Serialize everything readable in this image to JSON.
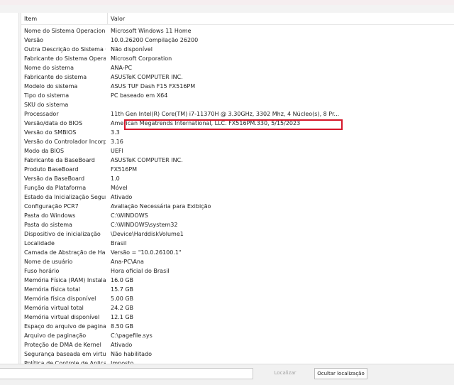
{
  "header": {
    "item": "Item",
    "value": "Valor"
  },
  "rows": [
    {
      "item": "Nome do Sistema Operacional",
      "value": "Microsoft Windows 11 Home"
    },
    {
      "item": "Versão",
      "value": "10.0.26200 Compilação 26200"
    },
    {
      "item": "Outra Descrição do Sistema O...",
      "value": "Não disponível"
    },
    {
      "item": "Fabricante do Sistema Operaci...",
      "value": "Microsoft Corporation"
    },
    {
      "item": "Nome do sistema",
      "value": "ANA-PC"
    },
    {
      "item": "Fabricante do sistema",
      "value": "ASUSTeK COMPUTER INC."
    },
    {
      "item": "Modelo do sistema",
      "value": "ASUS TUF Dash F15 FX516PM"
    },
    {
      "item": "Tipo do sistema",
      "value": "PC baseado em X64"
    },
    {
      "item": "SKU do sistema",
      "value": ""
    },
    {
      "item": "Processador",
      "value": "11th Gen Intel(R) Core(TM) i7-11370H @ 3.30GHz, 3302 Mhz, 4 Núcleo(s), 8 Pr..."
    },
    {
      "item": "Versão/data do BIOS",
      "value": "American Megatrends International, LLC. FX516PM.330, 5/15/2023"
    },
    {
      "item": "Versão do SMBIOS",
      "value": "3.3"
    },
    {
      "item": "Versão do Controlador Incorp...",
      "value": "3.16"
    },
    {
      "item": "Modo da BIOS",
      "value": "UEFI"
    },
    {
      "item": "Fabricante da BaseBoard",
      "value": "ASUSTeK COMPUTER INC."
    },
    {
      "item": "Produto BaseBoard",
      "value": "FX516PM"
    },
    {
      "item": "Versão da BaseBoard",
      "value": "1.0"
    },
    {
      "item": "Função da Plataforma",
      "value": "Móvel"
    },
    {
      "item": "Estado da Inicialização Segura",
      "value": "Ativado"
    },
    {
      "item": "Configuração PCR7",
      "value": "Avaliação Necessária para Exibição"
    },
    {
      "item": "Pasta do Windows",
      "value": "C:\\WINDOWS"
    },
    {
      "item": "Pasta do sistema",
      "value": "C:\\WINDOWS\\system32"
    },
    {
      "item": "Dispositivo de inicialização",
      "value": "\\Device\\HarddiskVolume1"
    },
    {
      "item": "Localidade",
      "value": "Brasil"
    },
    {
      "item": "Camada de Abstração de Hard...",
      "value": "Versão = \"10.0.26100.1\""
    },
    {
      "item": "Nome de usuário",
      "value": "Ana-PC\\Ana"
    },
    {
      "item": "Fuso horário",
      "value": "Hora oficial do Brasil"
    },
    {
      "item": "Memória Física (RAM) Instalada",
      "value": "16.0 GB"
    },
    {
      "item": "Memória física total",
      "value": "15.7 GB"
    },
    {
      "item": "Memória física disponível",
      "value": "5.00 GB"
    },
    {
      "item": "Memória virtual total",
      "value": "24.2 GB"
    },
    {
      "item": "Memória virtual disponível",
      "value": "12.1 GB"
    },
    {
      "item": "Espaço do arquivo de paginaç...",
      "value": "8.50 GB"
    },
    {
      "item": "Arquivo de paginação",
      "value": "C:\\pagefile.sys"
    },
    {
      "item": "Proteção de DMA de Kernel",
      "value": "Ativado"
    },
    {
      "item": "Segurança baseada em virtuali...",
      "value": "Não habilitado"
    },
    {
      "item": "Política de Controle de Aplicati...",
      "value": "Imposto"
    }
  ],
  "highlighted_row": "Processador",
  "highlight_color": "#d6182b",
  "search": {
    "value": ""
  },
  "buttons": {
    "find": "Localizar",
    "hide": "Ocultar localização"
  }
}
